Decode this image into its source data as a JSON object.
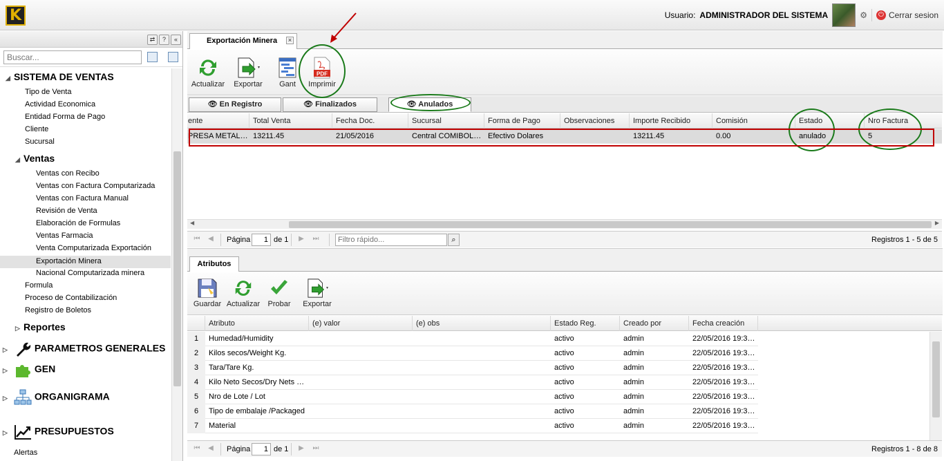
{
  "header": {
    "logo_letter": "K",
    "user_label": "Usuario:",
    "user_name": "ADMINISTRADOR DEL SISTEMA",
    "logout_label": "Cerrar sesion"
  },
  "left_panel": {
    "search_placeholder": "Buscar...",
    "tree": {
      "sistema_ventas": "SISTEMA DE VENTAS",
      "sv_items": [
        "Tipo de Venta",
        "Actividad Economica",
        "Entidad Forma de Pago",
        "Cliente",
        "Sucursal"
      ],
      "ventas": "Ventas",
      "ventas_items": [
        "Ventas con Recibo",
        "Ventas con Factura Computarizada",
        "Ventas con Factura Manual",
        "Revisión de Venta",
        "Elaboración de Formulas",
        "Ventas Farmacia",
        "Venta Computarizada Exportación",
        "Exportación Minera",
        "Nacional Computarizada minera"
      ],
      "sv_items2": [
        "Formula",
        "Proceso de Contabilización",
        "Registro de Boletos"
      ],
      "reportes": "Reportes",
      "parametros": "PARAMETROS GENERALES",
      "gen": "GEN",
      "organigrama": "ORGANIGRAMA",
      "presupuestos": "PRESUPUESTOS",
      "alertas": "Alertas"
    }
  },
  "main": {
    "tab_title": "Exportación Minera",
    "toolbar": {
      "actualizar": "Actualizar",
      "exportar": "Exportar",
      "gant": "Gant",
      "imprimir": "Imprimir",
      "pdf_text": "PDF"
    },
    "filter_tabs": [
      "En Registro",
      "Finalizados",
      "Anulados"
    ],
    "grid": {
      "columns": [
        "ente",
        "Total Venta",
        "Fecha Doc.",
        "Sucursal",
        "Forma de Pago",
        "Observaciones",
        "Importe Recibido",
        "Comisión",
        "Estado",
        "Nro Factura"
      ],
      "rows": [
        [
          "PRESA METAL…",
          "13211.45",
          "21/05/2016",
          "Central COMIBOL…",
          "Efectivo Dolares",
          "",
          "13211.45",
          "0.00",
          "anulado",
          "5"
        ]
      ]
    },
    "pager": {
      "page_label": "Página",
      "page_value": "1",
      "of_label": "de 1",
      "filter_placeholder": "Filtro rápido...",
      "records": "Registros 1 - 5 de 5"
    }
  },
  "atributos": {
    "tab_title": "Atributos",
    "toolbar": {
      "guardar": "Guardar",
      "actualizar": "Actualizar",
      "probar": "Probar",
      "exportar": "Exportar"
    },
    "columns": [
      "Atributo",
      "(e) valor",
      "(e) obs",
      "Estado Reg.",
      "Creado por",
      "Fecha creación"
    ],
    "rows": [
      [
        "1",
        "Humedad/Humidity",
        "",
        "",
        "activo",
        "admin",
        "22/05/2016 19:3…"
      ],
      [
        "2",
        "Kilos secos/Weight Kg.",
        "",
        "",
        "activo",
        "admin",
        "22/05/2016 19:3…"
      ],
      [
        "3",
        "Tara/Tare Kg.",
        "",
        "",
        "activo",
        "admin",
        "22/05/2016 19:3…"
      ],
      [
        "4",
        "Kilo Neto Secos/Dry Nets …",
        "",
        "",
        "activo",
        "admin",
        "22/05/2016 19:3…"
      ],
      [
        "5",
        "Nro de Lote / Lot",
        "",
        "",
        "activo",
        "admin",
        "22/05/2016 19:3…"
      ],
      [
        "6",
        "Tipo de embalaje /Packaged",
        "",
        "",
        "activo",
        "admin",
        "22/05/2016 19:3…"
      ],
      [
        "7",
        "Material",
        "",
        "",
        "activo",
        "admin",
        "22/05/2016 19:3…"
      ]
    ],
    "pager": {
      "page_label": "Página",
      "page_value": "1",
      "of_label": "de 1",
      "records": "Registros 1 - 8 de 8"
    }
  },
  "colors": {
    "annotation_green": "#1a7a1a",
    "annotation_red": "#c00000",
    "refresh_green": "#2f9e2f",
    "pdf_red": "#d52b1e"
  }
}
